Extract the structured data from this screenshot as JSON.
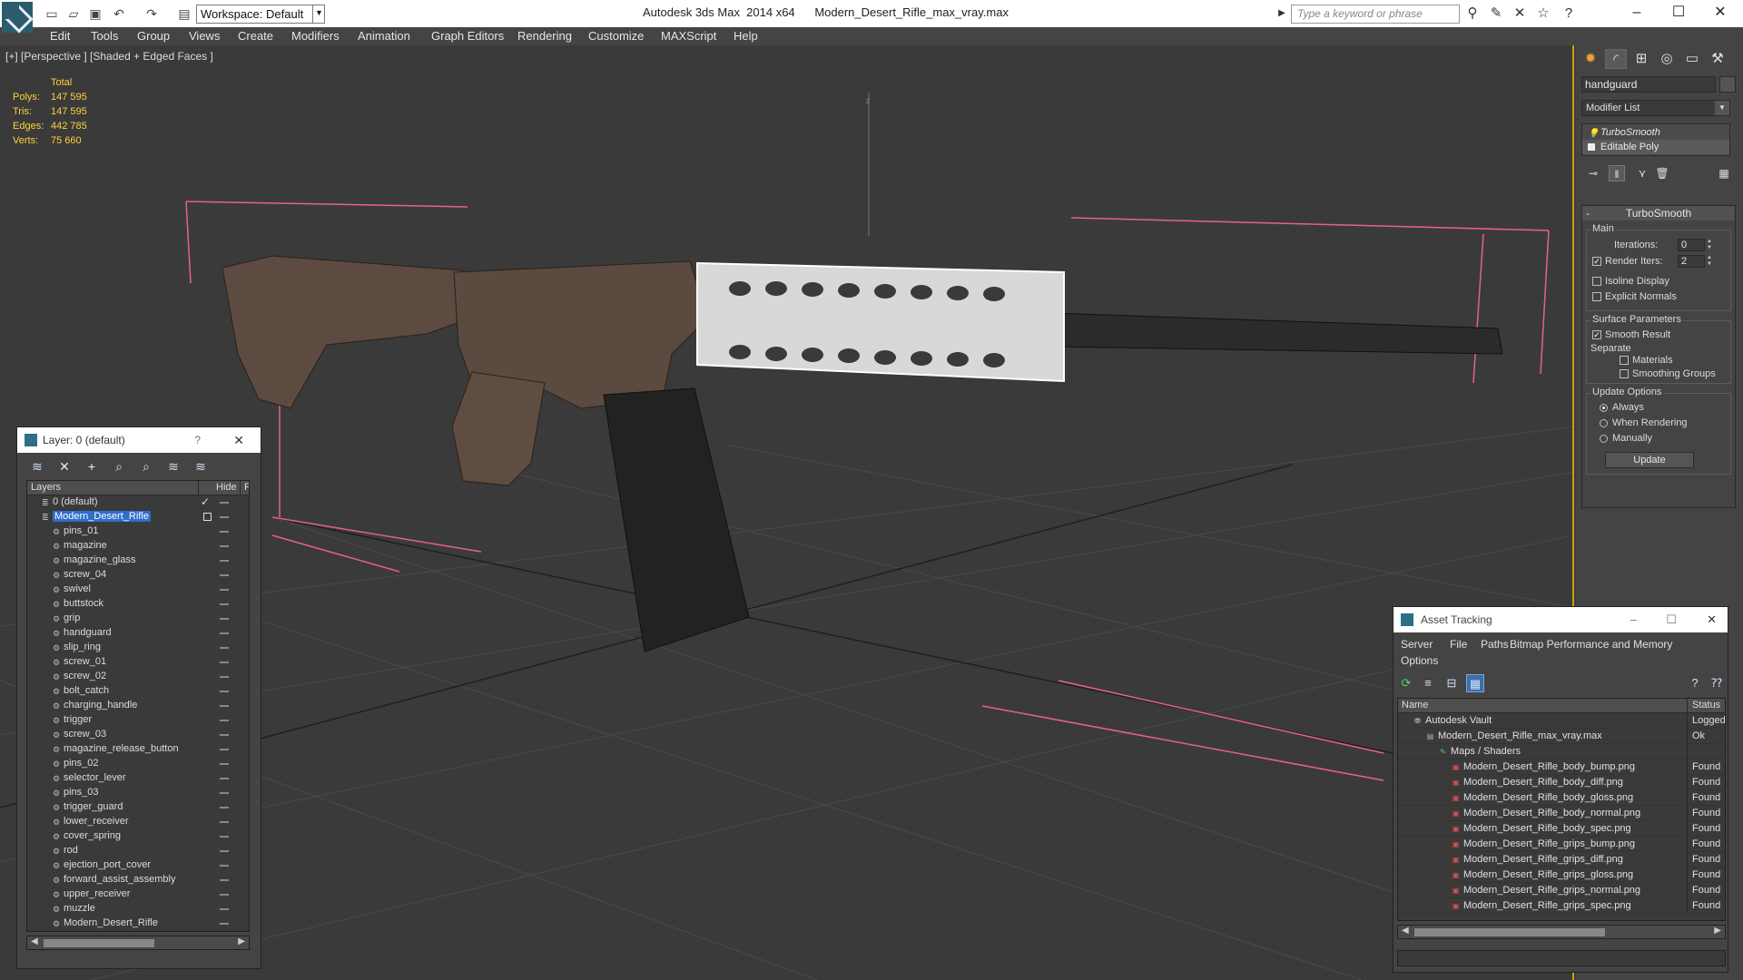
{
  "titlebar": {
    "workspace": "Workspace: Default",
    "app_title": "Autodesk 3ds Max  2014 x64      Modern_Desert_Rifle_max_vray.max",
    "search_placeholder": "Type a keyword or phrase"
  },
  "menu": [
    "Edit",
    "Tools",
    "Group",
    "Views",
    "Create",
    "Modifiers",
    "Animation",
    "Graph Editors",
    "Rendering",
    "Customize",
    "MAXScript",
    "Help"
  ],
  "viewport": {
    "label": "[+] [Perspective ] [Shaded + Edged Faces ]",
    "axis_label": "z",
    "stats": {
      "header": "Total",
      "rows": [
        {
          "label": "Polys:",
          "value": "147 595"
        },
        {
          "label": "Tris:",
          "value": "147 595"
        },
        {
          "label": "Edges:",
          "value": "442 785"
        },
        {
          "label": "Verts:",
          "value": "75 660"
        }
      ]
    }
  },
  "layer_dialog": {
    "title": "Layer: 0 (default)",
    "help": "?",
    "columns": {
      "layers": "Layers",
      "hide": "Hide",
      "freeze": "F"
    },
    "layers": [
      {
        "name": "0 (default)",
        "level": 0,
        "current": true
      },
      {
        "name": "Modern_Desert_Rifle",
        "level": 0,
        "selected": true
      },
      {
        "name": "pins_01",
        "level": 1
      },
      {
        "name": "magazine",
        "level": 1
      },
      {
        "name": "magazine_glass",
        "level": 1
      },
      {
        "name": "screw_04",
        "level": 1
      },
      {
        "name": "swivel",
        "level": 1
      },
      {
        "name": "buttstock",
        "level": 1
      },
      {
        "name": "grip",
        "level": 1
      },
      {
        "name": "handguard",
        "level": 1
      },
      {
        "name": "slip_ring",
        "level": 1
      },
      {
        "name": "screw_01",
        "level": 1
      },
      {
        "name": "screw_02",
        "level": 1
      },
      {
        "name": "bolt_catch",
        "level": 1
      },
      {
        "name": "charging_handle",
        "level": 1
      },
      {
        "name": "trigger",
        "level": 1
      },
      {
        "name": "screw_03",
        "level": 1
      },
      {
        "name": "magazine_release_button",
        "level": 1
      },
      {
        "name": "pins_02",
        "level": 1
      },
      {
        "name": "selector_lever",
        "level": 1
      },
      {
        "name": "pins_03",
        "level": 1
      },
      {
        "name": "trigger_guard",
        "level": 1
      },
      {
        "name": "lower_receiver",
        "level": 1
      },
      {
        "name": "cover_spring",
        "level": 1
      },
      {
        "name": "rod",
        "level": 1
      },
      {
        "name": "ejection_port_cover",
        "level": 1
      },
      {
        "name": "forward_assist_assembly",
        "level": 1
      },
      {
        "name": "upper_receiver",
        "level": 1
      },
      {
        "name": "muzzle",
        "level": 1
      },
      {
        "name": "Modern_Desert_Rifle",
        "level": 1
      }
    ]
  },
  "command_panel": {
    "object_name": "handguard",
    "modifier_list": "Modifier List",
    "stack": [
      "TurboSmooth",
      "Editable Poly"
    ],
    "rollout": {
      "title": "TurboSmooth",
      "main_label": "Main",
      "iterations_label": "Iterations:",
      "iterations_value": "0",
      "render_iters_label": "Render Iters:",
      "render_iters_value": "2",
      "isoline": "Isoline Display",
      "explicit_normals": "Explicit Normals",
      "surface_label": "Surface Parameters",
      "smooth_result": "Smooth Result",
      "separate_label": "Separate",
      "materials": "Materials",
      "smoothing_groups": "Smoothing Groups",
      "update_label": "Update Options",
      "always": "Always",
      "when_rendering": "When Rendering",
      "manually": "Manually",
      "update_button": "Update"
    }
  },
  "asset_tracking": {
    "title": "Asset Tracking",
    "menu": [
      "Server",
      "File",
      "Paths",
      "Bitmap Performance and Memory",
      "Options"
    ],
    "columns": {
      "name": "Name",
      "status": "Status"
    },
    "rows": [
      {
        "name": "Autodesk Vault",
        "status": "Logged Ou",
        "level": 0,
        "icon": "vault"
      },
      {
        "name": "Modern_Desert_Rifle_max_vray.max",
        "status": "Ok",
        "level": 1,
        "icon": "max"
      },
      {
        "name": "Maps / Shaders",
        "status": "",
        "level": 2,
        "icon": "maps"
      },
      {
        "name": "Modern_Desert_Rifle_body_bump.png",
        "status": "Found",
        "level": 3,
        "icon": "png"
      },
      {
        "name": "Modern_Desert_Rifle_body_diff.png",
        "status": "Found",
        "level": 3,
        "icon": "png"
      },
      {
        "name": "Modern_Desert_Rifle_body_gloss.png",
        "status": "Found",
        "level": 3,
        "icon": "png"
      },
      {
        "name": "Modern_Desert_Rifle_body_normal.png",
        "status": "Found",
        "level": 3,
        "icon": "png"
      },
      {
        "name": "Modern_Desert_Rifle_body_spec.png",
        "status": "Found",
        "level": 3,
        "icon": "png"
      },
      {
        "name": "Modern_Desert_Rifle_grips_bump.png",
        "status": "Found",
        "level": 3,
        "icon": "png"
      },
      {
        "name": "Modern_Desert_Rifle_grips_diff.png",
        "status": "Found",
        "level": 3,
        "icon": "png"
      },
      {
        "name": "Modern_Desert_Rifle_grips_gloss.png",
        "status": "Found",
        "level": 3,
        "icon": "png"
      },
      {
        "name": "Modern_Desert_Rifle_grips_normal.png",
        "status": "Found",
        "level": 3,
        "icon": "png"
      },
      {
        "name": "Modern_Desert_Rifle_grips_spec.png",
        "status": "Found",
        "level": 3,
        "icon": "png"
      }
    ]
  },
  "colors": {
    "stats_text": "#ffd23a",
    "selection": "#2f6dcc",
    "viewport_border": "#c7a500",
    "bounding_box": "#e8608a"
  }
}
